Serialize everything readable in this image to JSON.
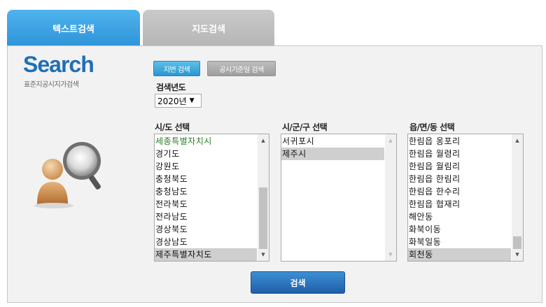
{
  "tabs": [
    {
      "label": "텍스트검색",
      "active": true
    },
    {
      "label": "지도검색",
      "active": false
    }
  ],
  "logo": {
    "title": "Search",
    "subtitle": "표준지공시지가검색"
  },
  "mode_buttons": {
    "lot_search": "지번 검색",
    "date_search": "공시기준일 검색"
  },
  "year": {
    "label": "검색년도",
    "value": "2020년"
  },
  "sido": {
    "label": "시/도 선택",
    "items": [
      "세종특별자치시",
      "경기도",
      "강원도",
      "충청북도",
      "충청남도",
      "전라북도",
      "전라남도",
      "경상북도",
      "경상남도",
      "제주특별자치도"
    ],
    "selected_index": 9
  },
  "sigungu": {
    "label": "시/군/구 선택",
    "items": [
      "서귀포시",
      "제주시"
    ],
    "selected_index": 1
  },
  "emd": {
    "label": "읍/면/동 선택",
    "items": [
      "한림읍 옹포리",
      "한림읍 월령리",
      "한림읍 월림리",
      "한림읍 한림리",
      "한림읍 한수리",
      "한림읍 협재리",
      "해안동",
      "화북이동",
      "화북일동",
      "회천동"
    ],
    "selected_index": 9
  },
  "search_button": {
    "label": "검색"
  },
  "colors": {
    "accent": "#2f94d8",
    "logo": "#1f6fb4",
    "panel": "#f2f2f2",
    "button": "#1f5ea8"
  },
  "icons": {
    "illustration": "user-magnifier-icon",
    "scroll_up": "scroll-up-arrow-icon",
    "scroll_down": "scroll-down-arrow-icon",
    "dropdown": "dropdown-caret-icon"
  }
}
